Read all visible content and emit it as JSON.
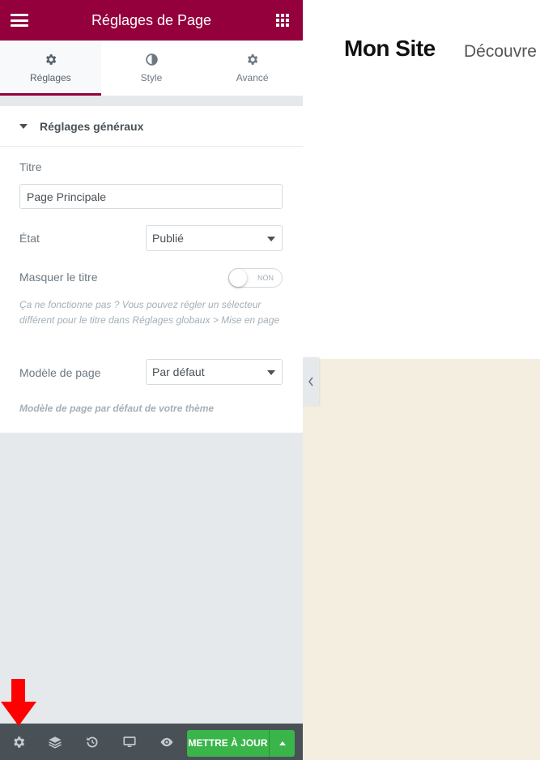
{
  "header": {
    "title": "Réglages de Page",
    "hamburger_icon": "hamburger-menu-icon",
    "grid_icon": "apps-grid-icon"
  },
  "tabs": [
    {
      "label": "Réglages",
      "icon": "gear-icon",
      "active": true
    },
    {
      "label": "Style",
      "icon": "half-circle-contrast-icon",
      "active": false
    },
    {
      "label": "Avancé",
      "icon": "gear-icon",
      "active": false
    }
  ],
  "section": {
    "title": "Réglages généraux",
    "titre_label": "Titre",
    "titre_value": "Page Principale",
    "etat_label": "État",
    "etat_value": "Publié",
    "masquer_label": "Masquer le titre",
    "masquer_toggle": "NON",
    "help_text": "Ça ne fonctionne pas ? Vous pouvez régler un sélecteur différent pour le titre dans Réglages globaux > Mise en page",
    "modele_label": "Modèle de page",
    "modele_value": "Par défaut",
    "modele_help": "Modèle de page par défaut de votre thème"
  },
  "footer": {
    "icons": [
      "gear-icon",
      "layers-icon",
      "history-icon",
      "desktop-icon",
      "eye-icon"
    ],
    "update_label": "METTRE À JOUR"
  },
  "preview": {
    "site_title": "Mon Site",
    "nav_item": "Découvre"
  },
  "colors": {
    "brand": "#93003c",
    "update": "#39b54a",
    "footer": "#495157",
    "cream": "#f4eee0",
    "annotation": "#ff0000"
  }
}
